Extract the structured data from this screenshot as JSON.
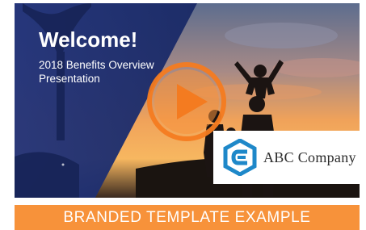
{
  "slide": {
    "title": "Welcome!",
    "subtitle_line1": "2018 Benefits Overview",
    "subtitle_line2": "Presentation"
  },
  "logo": {
    "company_name": "ABC Company",
    "icon": "hexagon-e-logo-icon"
  },
  "banner": {
    "text": "BRANDED TEMPLATE EXAMPLE"
  },
  "controls": {
    "play_icon": "play-icon"
  },
  "colors": {
    "navy": "#1d2f6e",
    "orange": "#f7923a",
    "play_orange": "#f47b20",
    "logo_blue": "#1e88c9",
    "banner_orange": "#f7923a"
  }
}
